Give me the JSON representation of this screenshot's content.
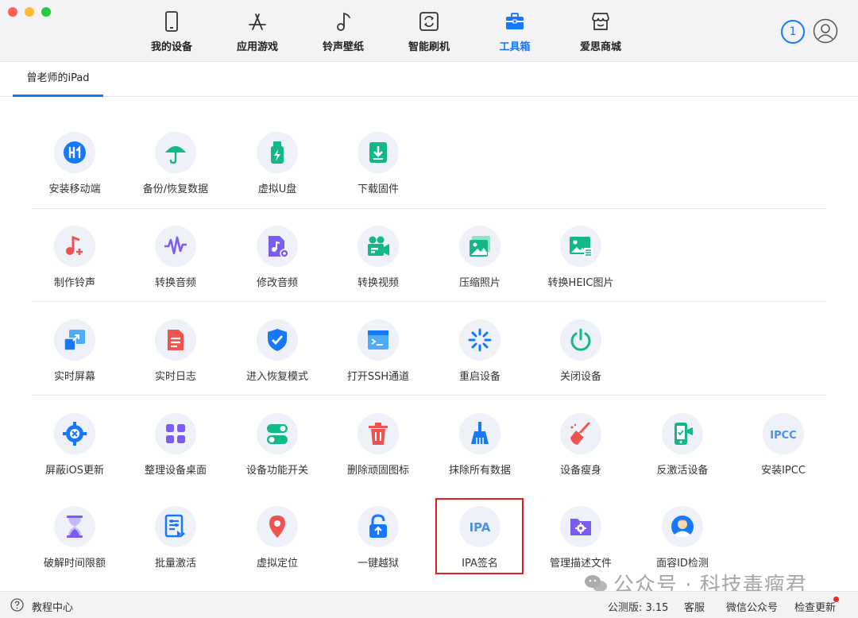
{
  "window": {
    "nav": [
      {
        "label": "我的设备",
        "icon": "phone-icon",
        "active": false
      },
      {
        "label": "应用游戏",
        "icon": "app-store-icon",
        "active": false
      },
      {
        "label": "铃声壁纸",
        "icon": "music-note-icon",
        "active": false
      },
      {
        "label": "智能刷机",
        "icon": "refresh-device-icon",
        "active": false
      },
      {
        "label": "工具箱",
        "icon": "toolbox-icon",
        "active": true
      },
      {
        "label": "爱思商城",
        "icon": "store-icon",
        "active": false
      }
    ],
    "notification_count": "1"
  },
  "device_tab": {
    "label": "曾老师的iPad"
  },
  "tools": [
    [
      {
        "label": "安装移动端",
        "icon": "aisi-logo-icon"
      },
      {
        "label": "备份/恢复数据",
        "icon": "umbrella-icon"
      },
      {
        "label": "虚拟U盘",
        "icon": "usb-drive-icon"
      },
      {
        "label": "下载固件",
        "icon": "download-icon"
      }
    ],
    [
      {
        "label": "制作铃声",
        "icon": "ringtone-icon"
      },
      {
        "label": "转换音频",
        "icon": "audio-wave-icon"
      },
      {
        "label": "修改音频",
        "icon": "audio-file-icon"
      },
      {
        "label": "转换视频",
        "icon": "video-camera-icon"
      },
      {
        "label": "压缩照片",
        "icon": "photo-icon"
      },
      {
        "label": "转换HEIC图片",
        "icon": "heic-image-icon"
      }
    ],
    [
      {
        "label": "实时屏幕",
        "icon": "screen-mirror-icon"
      },
      {
        "label": "实时日志",
        "icon": "log-file-icon"
      },
      {
        "label": "进入恢复模式",
        "icon": "shield-check-icon"
      },
      {
        "label": "打开SSH通道",
        "icon": "terminal-icon"
      },
      {
        "label": "重启设备",
        "icon": "spinner-icon"
      },
      {
        "label": "关闭设备",
        "icon": "power-icon"
      }
    ],
    [
      {
        "label": "屏蔽iOS更新",
        "icon": "gear-block-icon"
      },
      {
        "label": "整理设备桌面",
        "icon": "grid-icon"
      },
      {
        "label": "设备功能开关",
        "icon": "toggle-icon"
      },
      {
        "label": "删除顽固图标",
        "icon": "trash-icon"
      },
      {
        "label": "抹除所有数据",
        "icon": "broom-icon"
      },
      {
        "label": "设备瘦身",
        "icon": "sweep-icon"
      },
      {
        "label": "反激活设备",
        "icon": "phone-deactivate-icon"
      },
      {
        "label": "安装IPCC",
        "icon": "ipcc-text-icon",
        "text": "IPCC"
      }
    ],
    [
      {
        "label": "破解时间限额",
        "icon": "hourglass-icon"
      },
      {
        "label": "批量激活",
        "icon": "batch-activate-icon"
      },
      {
        "label": "虚拟定位",
        "icon": "location-pin-icon"
      },
      {
        "label": "一键越狱",
        "icon": "unlock-icon"
      },
      {
        "label": "IPA签名",
        "icon": "ipa-text-icon",
        "text": "IPA"
      },
      {
        "label": "管理描述文件",
        "icon": "profile-folder-icon"
      },
      {
        "label": "面容ID检测",
        "icon": "face-id-icon"
      }
    ]
  ],
  "status_bar": {
    "help_label": "教程中心",
    "version": "公测版: 3.15",
    "support": "客服",
    "wechat": "微信公众号",
    "update": "检查更新"
  },
  "watermark": "公众号 · 科技毒瘤君",
  "colors": {
    "accent": "#1677ff",
    "highlight": "#e02020",
    "icon_bg": "#eef2f8"
  }
}
